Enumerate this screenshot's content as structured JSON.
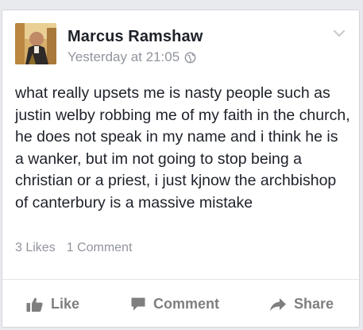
{
  "post": {
    "author": "Marcus Ramshaw",
    "timestamp": "Yesterday at 21:05",
    "privacy_icon": "globe-icon",
    "menu_icon": "chevron-down-icon",
    "text": "what really upsets me is nasty people such as justin welby robbing me of my faith in the church, he does not speak in my name and i think he is a wanker, but im not going to stop being a christian or a priest, i just kjnow the archbishop of canterbury is a massive mistake",
    "likes": "3 Likes",
    "comments": "1 Comment"
  },
  "actions": {
    "like_label": "Like",
    "comment_label": "Comment",
    "share_label": "Share"
  },
  "colors": {
    "author": "#1d2129",
    "meta": "#90949c",
    "action": "#7f7f7f"
  }
}
